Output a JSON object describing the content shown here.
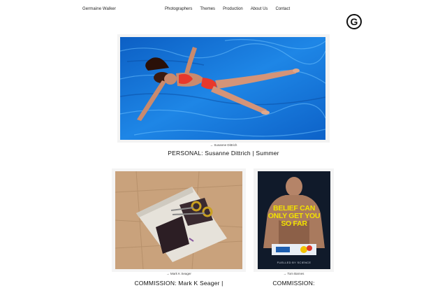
{
  "header": {
    "brand": "Germaine Walker",
    "nav": [
      "Photographers",
      "Themes",
      "Production",
      "About Us",
      "Contact"
    ],
    "logo_letter": "G"
  },
  "feature": {
    "credit": "→ Susanne Dittrich",
    "title": "PERSONAL: Susanne Dittrich | Summer"
  },
  "cards": [
    {
      "credit": "→ Mark K Seager",
      "title": "COMMISSION: Mark K Seager |"
    },
    {
      "credit": "→ Tom Barnes",
      "title": "COMMISSION:",
      "poster_lines": [
        "BELIEF CAN",
        "ONLY GET YOU",
        "SO FAR"
      ],
      "poster_tag": "FUELLED BY SCIENCE"
    }
  ],
  "colors": {
    "pool": "#1a73d6",
    "accent_yellow": "#f2e200",
    "text": "#111111"
  }
}
